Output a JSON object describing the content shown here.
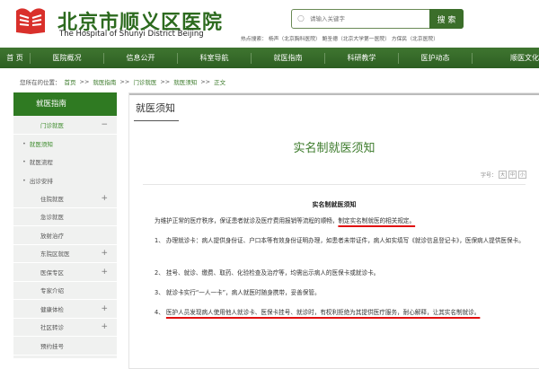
{
  "header": {
    "title_cn": "北京市顺义区医院",
    "title_en": "The Hospital of Shunyi District Beijing",
    "search_placeholder": "请输入关键字",
    "search_button": "搜 索",
    "hot_search": "热点搜索： 杨声（北京胸科医院） 鲍圣德（北京大学第一医院） 方保民（北京医院）"
  },
  "nav": [
    "首 页",
    "医院概况",
    "信息公开",
    "科室导航",
    "就医指南",
    "科研教学",
    "医护动态",
    "顺医文化"
  ],
  "breadcrumb": {
    "prefix": "您所在的位置：",
    "items": [
      "首页",
      ">>",
      "就医指南",
      ">>",
      "门诊就医",
      ">>",
      "就医须知",
      ">>",
      "正文"
    ]
  },
  "sidebar": {
    "title": "就医指南",
    "items": [
      {
        "label": "门诊就医",
        "mark": "−",
        "type": "top"
      },
      {
        "label": "就医须知",
        "type": "sub",
        "active": true
      },
      {
        "label": "就医流程",
        "type": "sub"
      },
      {
        "label": "出诊安排",
        "type": "sub"
      },
      {
        "label": "住院就医",
        "mark": "+",
        "type": "top"
      },
      {
        "label": "急诊就医",
        "type": "top"
      },
      {
        "label": "放射治疗",
        "type": "top"
      },
      {
        "label": "东院区就医",
        "mark": "+",
        "type": "top"
      },
      {
        "label": "医保专区",
        "mark": "+",
        "type": "top"
      },
      {
        "label": "专家介绍",
        "type": "top"
      },
      {
        "label": "健康体检",
        "mark": "+",
        "type": "top"
      },
      {
        "label": "社区转诊",
        "mark": "+",
        "type": "top"
      },
      {
        "label": "预约挂号",
        "type": "top"
      }
    ]
  },
  "main": {
    "tab": "就医须知",
    "title": "实名制就医须知",
    "font_label": "字号：",
    "font_buttons": [
      "大",
      "中",
      "小"
    ],
    "article_title": "实名制就医须知",
    "p0a": "为维护正常的医疗秩序，保证患者就诊及医疗费用报销等流程的顺畅，",
    "p0b": "制定实名制就医的相关规定。",
    "p1": "1、 办理就诊卡：病人提供身份证、户口本等有效身份证明办理，如患者未带证件，病人如实填写《就诊信息登记卡》，医保病人提供医保卡。",
    "p2": "2、 挂号、就诊、缴费、取药、化验检查及治疗等，均需出示病人的医保卡或就诊卡。",
    "p3": "3、 就诊卡实行“一人一卡”，病人就医时随身携带，妥善保管。",
    "p4a": "4、 ",
    "p4b": "医护人员发现病人使用他人就诊卡、医保卡挂号、就诊时，有权利拒绝为其提供医疗服务，耐心解释，让其实名制就诊。"
  },
  "colors": {
    "brand_green": "#2f7a22",
    "underline_red": "#e01010"
  }
}
